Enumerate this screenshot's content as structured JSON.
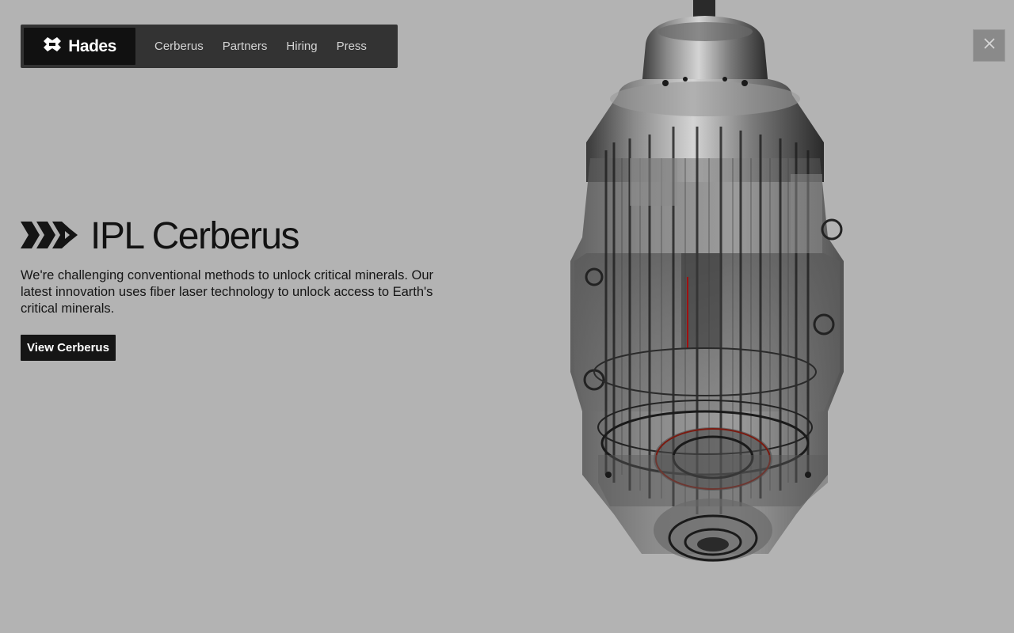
{
  "nav": {
    "brand": "Hades",
    "brand_icon": "hades-logo-icon",
    "links": [
      {
        "label": "Cerberus"
      },
      {
        "label": "Partners"
      },
      {
        "label": "Hiring"
      },
      {
        "label": "Press"
      }
    ]
  },
  "close": {
    "icon": "close-icon",
    "glyph": "✕"
  },
  "hero": {
    "logo_icon": "ipl-logo-icon",
    "title": "IPL Cerberus",
    "description": "We're challenging conventional methods to unlock critical minerals. Our latest innovation uses fiber laser technology to unlock access to Earth's critical minerals.",
    "cta_label": "View Cerberus"
  },
  "colors": {
    "background": "#b3b3b3",
    "nav_bg": "#333333",
    "brand_bg": "#111111",
    "button_bg": "#151515",
    "close_bg": "#8a8a8a"
  }
}
